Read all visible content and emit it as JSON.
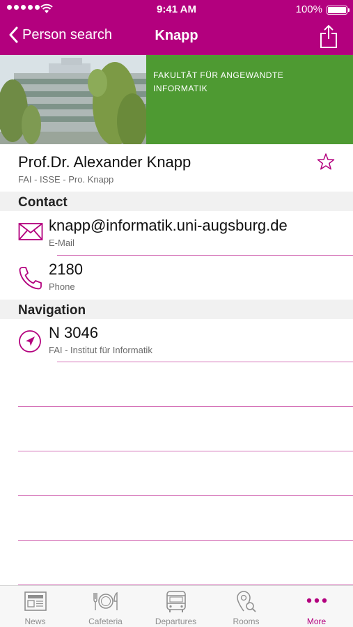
{
  "status_bar": {
    "time": "9:41 AM",
    "battery": "100%"
  },
  "nav": {
    "back_label": "Person search",
    "title": "Knapp"
  },
  "banner": {
    "faculty_line1": "FAKULTÄT FÜR ANGEWANDTE",
    "faculty_line2": "INFORMATIK"
  },
  "profile": {
    "name": "Prof.Dr. Alexander Knapp",
    "subtitle": "FAI - ISSE - Pro. Knapp"
  },
  "contact": {
    "header": "Contact",
    "email": {
      "value": "knapp@informatik.uni-augsburg.de",
      "label": "E-Mail"
    },
    "phone": {
      "value": "2180",
      "label": "Phone"
    }
  },
  "navigation": {
    "header": "Navigation",
    "room": {
      "value": "N 3046",
      "label": "FAI - Institut für Informatik"
    }
  },
  "tabbar": {
    "tabs": [
      {
        "label": "News",
        "icon": "newspaper-icon"
      },
      {
        "label": "Cafeteria",
        "icon": "plate-cutlery-icon"
      },
      {
        "label": "Departures",
        "icon": "bus-icon"
      },
      {
        "label": "Rooms",
        "icon": "map-pin-search-icon"
      },
      {
        "label": "More",
        "icon": "more-dots-icon"
      }
    ]
  },
  "colors": {
    "accent": "#b3007e",
    "faculty_green": "#4e9a32"
  }
}
